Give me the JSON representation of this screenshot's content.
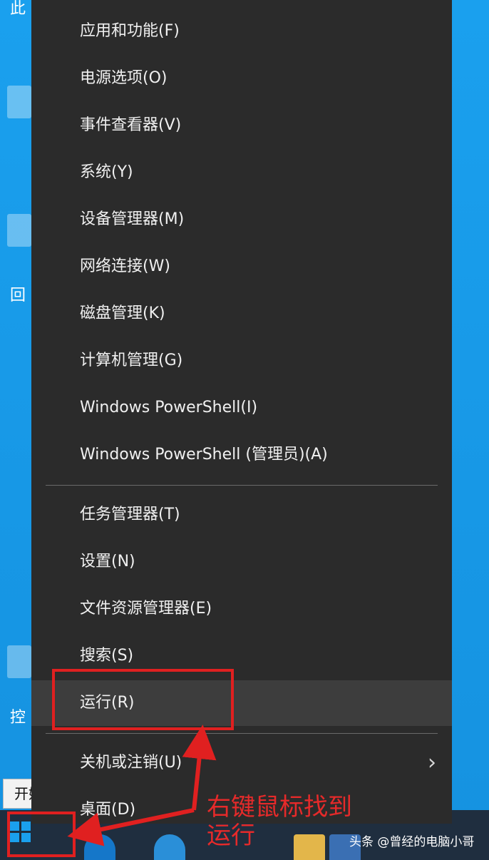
{
  "desktop": {
    "labels": [
      "此",
      "回",
      "控"
    ]
  },
  "menu": {
    "items": [
      {
        "label": "应用和功能(F)"
      },
      {
        "label": "电源选项(O)"
      },
      {
        "label": "事件查看器(V)"
      },
      {
        "label": "系统(Y)"
      },
      {
        "label": "设备管理器(M)"
      },
      {
        "label": "网络连接(W)"
      },
      {
        "label": "磁盘管理(K)"
      },
      {
        "label": "计算机管理(G)"
      },
      {
        "label": "Windows PowerShell(I)"
      },
      {
        "label": "Windows PowerShell (管理员)(A)"
      },
      {
        "label": "任务管理器(T)"
      },
      {
        "label": "设置(N)"
      },
      {
        "label": "文件资源管理器(E)"
      },
      {
        "label": "搜索(S)"
      },
      {
        "label": "运行(R)",
        "highlighted": true
      },
      {
        "label": "关机或注销(U)",
        "has_submenu": true
      },
      {
        "label": "桌面(D)"
      }
    ]
  },
  "tooltip": {
    "text": "开始"
  },
  "annotation": {
    "line1": "右键鼠标找到",
    "line2": "运行",
    "color": "#e02020"
  },
  "watermark": {
    "text": "头条 @曾经的电脑小哥"
  },
  "colors": {
    "menu_bg": "#2b2b2b",
    "highlight_bg": "#3d3d3d",
    "desktop_bg": "#1aa0ee",
    "taskbar_bg": "#1f2e3f"
  }
}
